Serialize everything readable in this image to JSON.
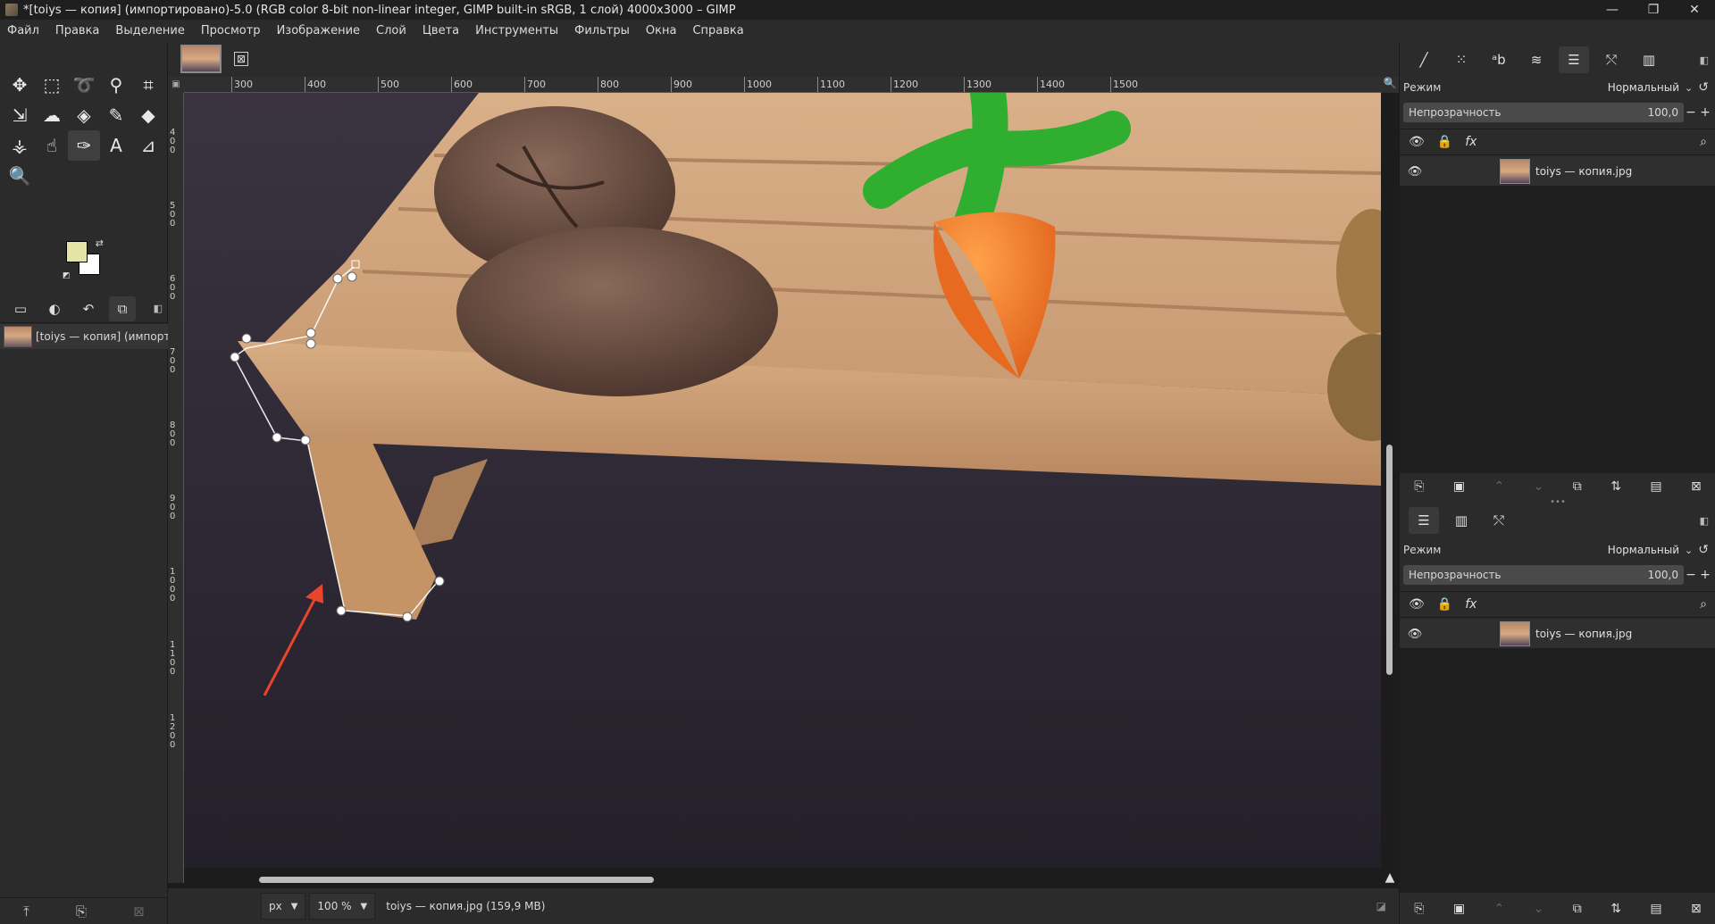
{
  "window": {
    "title": "*[toiys — копия] (импортировано)-5.0 (RGB color 8-bit non-linear integer, GIMP built-in sRGB, 1 слой) 4000x3000 – GIMP",
    "minimize": "—",
    "maximize": "❐",
    "close": "✕"
  },
  "menu": [
    "Файл",
    "Правка",
    "Выделение",
    "Просмотр",
    "Изображение",
    "Слой",
    "Цвета",
    "Инструменты",
    "Фильтры",
    "Окна",
    "Справка"
  ],
  "toolbox": {
    "tools": [
      {
        "name": "move-tool",
        "glyph": "✥"
      },
      {
        "name": "rect-select-tool",
        "glyph": "⬚"
      },
      {
        "name": "free-select-tool",
        "glyph": "➰"
      },
      {
        "name": "fuzzy-select-tool",
        "glyph": "⚲"
      },
      {
        "name": "crop-tool",
        "glyph": "⌗"
      },
      {
        "name": "unified-transform-tool",
        "glyph": "⇲"
      },
      {
        "name": "warp-transform-tool",
        "glyph": "☁"
      },
      {
        "name": "bucket-fill-tool",
        "glyph": "◈"
      },
      {
        "name": "paintbrush-tool",
        "glyph": "✎"
      },
      {
        "name": "eraser-tool",
        "glyph": "◆"
      },
      {
        "name": "clone-tool",
        "glyph": "⚶"
      },
      {
        "name": "smudge-tool",
        "glyph": "☝"
      },
      {
        "name": "paths-tool",
        "glyph": "✑"
      },
      {
        "name": "text-tool",
        "glyph": "A"
      },
      {
        "name": "measure-tool",
        "glyph": "⊿"
      },
      {
        "name": "zoom-tool",
        "glyph": "🔍"
      }
    ],
    "active_tool": "paths-tool",
    "fg_color": "#e4e4a6",
    "bg_color": "#ffffff",
    "image_list_item": "[toiys — копия] (импортир"
  },
  "image_tab": {
    "close": "⊠"
  },
  "ruler": {
    "top": [
      "300",
      "400",
      "500",
      "600",
      "700",
      "800",
      "900",
      "1000",
      "1100",
      "1200",
      "1300",
      "1400",
      "1500"
    ],
    "left": [
      "400",
      "500",
      "600",
      "700",
      "800",
      "900",
      "1000",
      "1100",
      "1200"
    ]
  },
  "status": {
    "unit": "px",
    "zoom": "100 %",
    "file": "toiys — копия.jpg (159,9 MB)"
  },
  "layers_panel": {
    "mode_label": "Режим",
    "mode_value": "Нормальный",
    "opacity_label": "Непрозрачность",
    "opacity_value": "100,0",
    "layer_name": "toiys — копия.jpg"
  },
  "layers_panel_2": {
    "mode_label": "Режим",
    "mode_value": "Нормальный",
    "opacity_label": "Непрозрачность",
    "opacity_value": "100,0",
    "layer_name": "toiys — копия.jpg"
  }
}
